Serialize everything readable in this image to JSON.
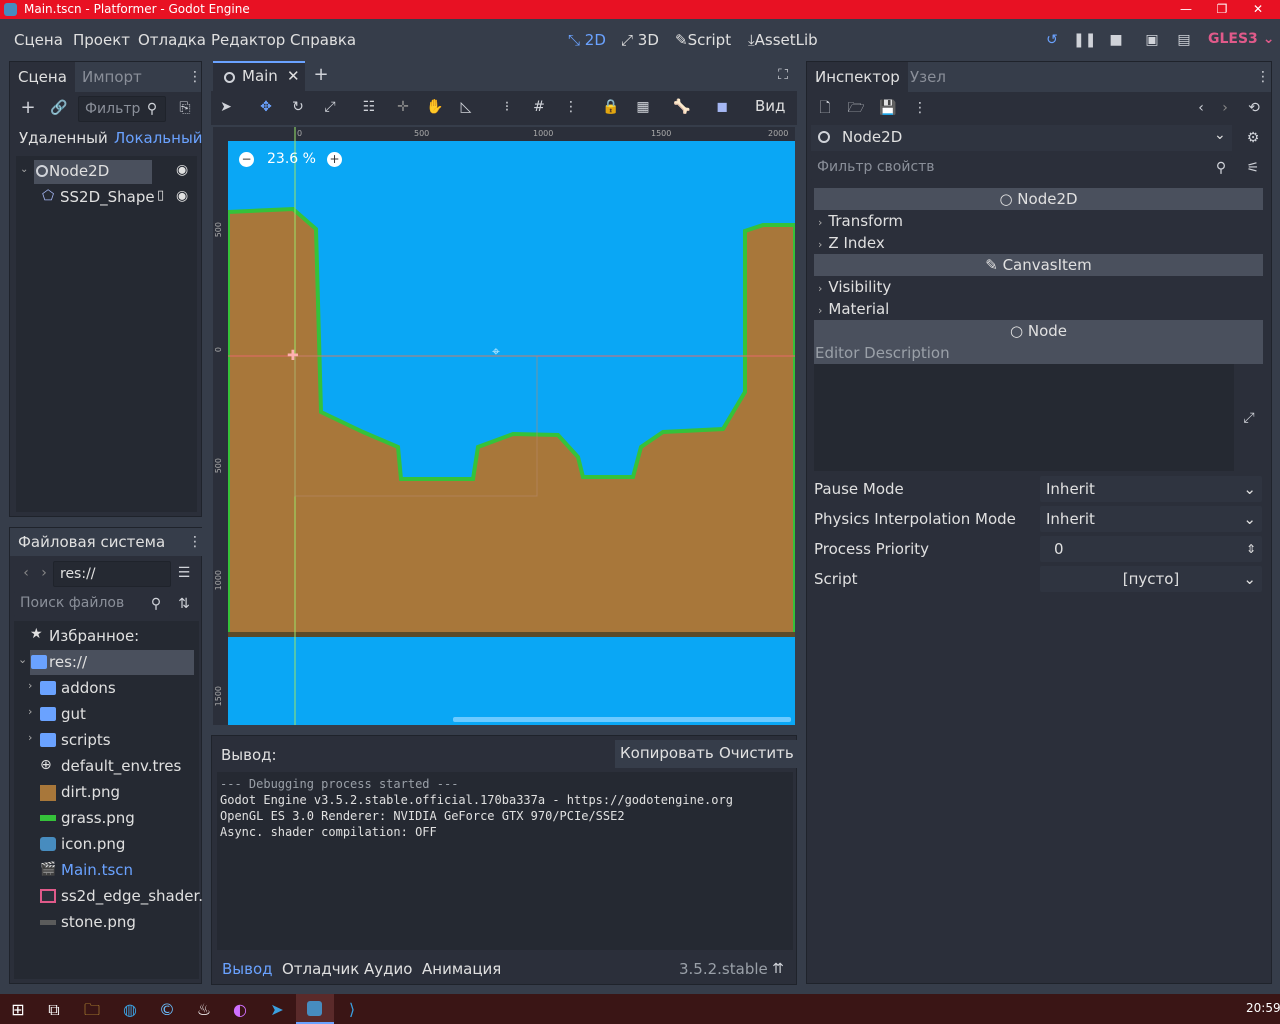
{
  "window": {
    "title": "Main.tscn - Platformer - Godot Engine"
  },
  "menu": {
    "items": [
      "Сцена",
      "Проект",
      "Отладка",
      "Редактор",
      "Справка"
    ]
  },
  "modes": {
    "d2": "2D",
    "d3": "3D",
    "script": "Script",
    "assetlib": "AssetLib"
  },
  "renderer": "GLES3",
  "scene_dock": {
    "tab_scene": "Сцена",
    "tab_import": "Импорт",
    "filter_placeholder": "Фильтр",
    "remote": "Удаленный",
    "local": "Локальный",
    "tree": [
      {
        "label": "Node2D"
      },
      {
        "label": "SS2D_Shape"
      }
    ]
  },
  "filesystem": {
    "title": "Файловая система",
    "path": "res://",
    "search_placeholder": "Поиск файлов",
    "favorites": "Избранное:",
    "root": "res://",
    "items": [
      "addons",
      "gut",
      "scripts",
      "default_env.tres",
      "dirt.png",
      "grass.png",
      "icon.png",
      "Main.tscn",
      "ss2d_edge_shader.",
      "stone.png"
    ]
  },
  "editor": {
    "tab": "Main",
    "view_menu": "Вид",
    "zoom": "23.6 %",
    "ruler_top": [
      "0",
      "500",
      "1000",
      "1500",
      "2000"
    ],
    "ruler_left": [
      "500",
      "0",
      "500",
      "1000",
      "1500"
    ]
  },
  "output": {
    "title": "Вывод:",
    "copy": "Копировать",
    "clear": "Очистить",
    "lines": [
      "--- Debugging process started ---",
      "Godot Engine v3.5.2.stable.official.170ba337a - https://godotengine.org",
      "OpenGL ES 3.0 Renderer: NVIDIA GeForce GTX 970/PCIe/SSE2",
      "Async. shader compilation: OFF"
    ]
  },
  "bottom_tabs": {
    "output": "Вывод",
    "debugger": "Отладчик",
    "audio": "Аудио",
    "animation": "Анимация",
    "version": "3.5.2.stable"
  },
  "inspector": {
    "tab_inspector": "Инспектор",
    "tab_node": "Узел",
    "node": "Node2D",
    "filter_placeholder": "Фильтр свойств",
    "sec_node2d": "Node2D",
    "transform": "Transform",
    "zindex": "Z Index",
    "sec_canvas": "CanvasItem",
    "visibility": "Visibility",
    "material": "Material",
    "sec_node": "Node",
    "editor_desc": "Editor Description",
    "pause_mode": "Pause Mode",
    "pause_val": "Inherit",
    "phys_mode": "Physics Interpolation Mode",
    "phys_val": "Inherit",
    "priority": "Process Priority",
    "priority_val": "0",
    "script": "Script",
    "script_val": "[пусто]"
  },
  "taskbar": {
    "time": "20:59"
  },
  "colors": {
    "accent": "#6aa2ff",
    "sky": "#0aa7f5",
    "dirt": "#a8773a",
    "grass": "#35c23a",
    "titlebar": "#e81123"
  }
}
